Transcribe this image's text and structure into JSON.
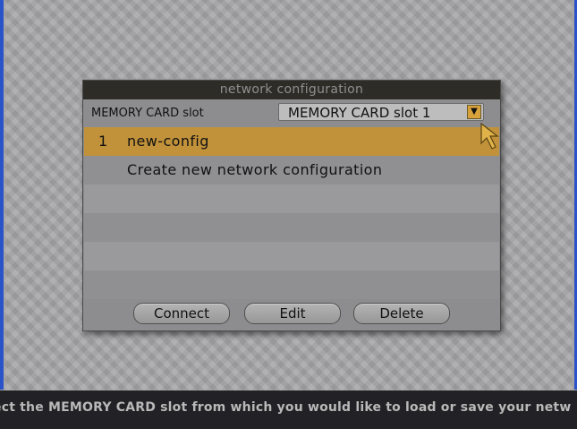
{
  "dialog": {
    "title": "network configuration",
    "slot_label": "MEMORY CARD slot",
    "slot_value": "MEMORY CARD slot 1",
    "slot_arrow": "▼"
  },
  "list": {
    "items": [
      {
        "number": "1",
        "name": "new-config"
      },
      {
        "number": "",
        "name": "Create new network configuration"
      }
    ]
  },
  "buttons": {
    "connect": "Connect",
    "edit": "Edit",
    "delete": "Delete"
  },
  "status": {
    "message": "ect the MEMORY CARD slot from which you would like to load or save your netw"
  },
  "colors": {
    "accent": "#c1923a",
    "title_bar": "#2e2c27",
    "status_bar": "#222226"
  },
  "icons": {
    "dropdown": "chevron-down-icon",
    "pointer": "cursor-arrow-icon"
  }
}
